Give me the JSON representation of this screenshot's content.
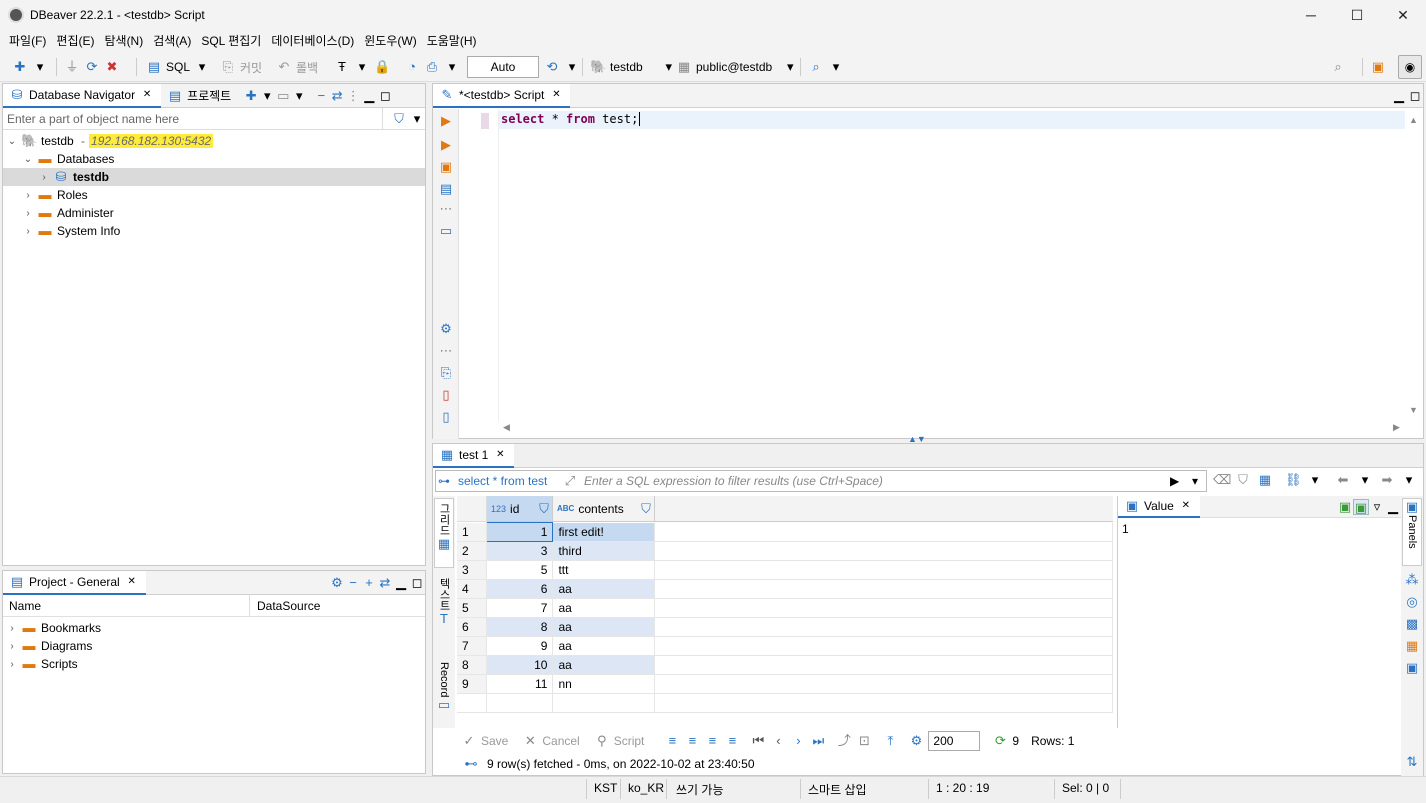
{
  "window": {
    "title": "DBeaver 22.2.1 - <testdb> Script",
    "minimize": "─",
    "maximize": "☐",
    "close": "✕"
  },
  "menu": [
    "파일(F)",
    "편집(E)",
    "탐색(N)",
    "검색(A)",
    "SQL 편집기",
    "데이터베이스(D)",
    "윈도우(W)",
    "도움말(H)"
  ],
  "toolbar": {
    "sql_label": "SQL",
    "commit_label": "커밋",
    "rollback_label": "롤백",
    "tx_mode": "Auto",
    "datasource": "testdb",
    "schema": "public@testdb"
  },
  "navigator": {
    "tab_label": "Database Navigator",
    "projects_tab": "프로젝트",
    "filter_placeholder": "Enter a part of object name here",
    "connection": "testdb",
    "host": "192.168.182.130:5432",
    "databases": "Databases",
    "db": "testdb",
    "roles": "Roles",
    "administer": "Administer",
    "system_info": "System Info"
  },
  "project": {
    "tab_label": "Project - General",
    "col_name": "Name",
    "col_ds": "DataSource",
    "items": [
      "Bookmarks",
      "Diagrams",
      "Scripts"
    ]
  },
  "editor": {
    "tab_label": "*<testdb> Script",
    "sql": "select * from test;",
    "kw1": "select",
    "rest1": " * ",
    "kw2": "from",
    "rest2": " test;"
  },
  "results": {
    "tab_label": "test 1",
    "query_label": "select * from test",
    "filter_placeholder": "Enter a SQL expression to filter results (use Ctrl+Space)",
    "col_id": "id",
    "col_contents": "contents",
    "id_type": "123",
    "contents_type": "ABC",
    "rows": [
      {
        "n": "1",
        "id": "1",
        "contents": "first edit!"
      },
      {
        "n": "2",
        "id": "3",
        "contents": "third"
      },
      {
        "n": "3",
        "id": "5",
        "contents": "ttt"
      },
      {
        "n": "4",
        "id": "6",
        "contents": "aa"
      },
      {
        "n": "5",
        "id": "7",
        "contents": "aa"
      },
      {
        "n": "6",
        "id": "8",
        "contents": "aa"
      },
      {
        "n": "7",
        "id": "9",
        "contents": "aa"
      },
      {
        "n": "8",
        "id": "10",
        "contents": "aa"
      },
      {
        "n": "9",
        "id": "11",
        "contents": "nn"
      }
    ],
    "side_grid": "그리드",
    "side_text": "텍스트",
    "side_record": "Record",
    "value_tab": "Value",
    "value": "1",
    "panels_label": "Panels",
    "save": "Save",
    "cancel": "Cancel",
    "script": "Script",
    "fetch_size": "200",
    "row_count": "9",
    "rows_label": "Rows: 1",
    "fetch_status": "9 row(s) fetched - 0ms, on 2022-10-02 at 23:40:50"
  },
  "status": {
    "tz": "KST",
    "locale": "ko_KR",
    "mode": "쓰기 가능",
    "insert": "스마트 삽입",
    "pos": "1 : 20 : 19",
    "sel": "Sel: 0 | 0"
  },
  "colors": {
    "accent": "#2b73c2",
    "keyword": "#7f0055",
    "highlight": "#ffeb3b",
    "selected_row": "#c5d9f1",
    "alt_row": "#dce6f4"
  }
}
